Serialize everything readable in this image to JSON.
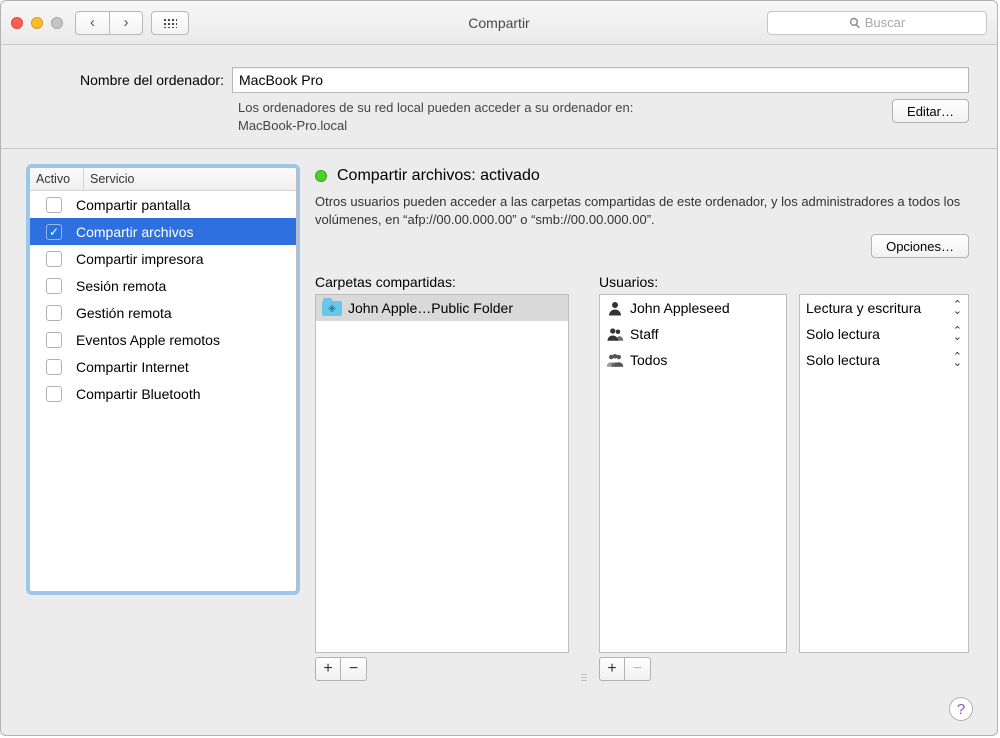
{
  "window": {
    "title": "Compartir",
    "search_placeholder": "Buscar"
  },
  "computerName": {
    "label": "Nombre del ordenador:",
    "value": "MacBook Pro",
    "hint_line1": "Los ordenadores de su red local pueden acceder a su ordenador en:",
    "hint_line2": "MacBook-Pro.local",
    "edit_button": "Editar…"
  },
  "services": {
    "header_active": "Activo",
    "header_service": "Servicio",
    "items": [
      {
        "label": "Compartir pantalla",
        "checked": false,
        "selected": false
      },
      {
        "label": "Compartir archivos",
        "checked": true,
        "selected": true
      },
      {
        "label": "Compartir impresora",
        "checked": false,
        "selected": false
      },
      {
        "label": "Sesión remota",
        "checked": false,
        "selected": false
      },
      {
        "label": "Gestión remota",
        "checked": false,
        "selected": false
      },
      {
        "label": "Eventos Apple remotos",
        "checked": false,
        "selected": false
      },
      {
        "label": "Compartir Internet",
        "checked": false,
        "selected": false
      },
      {
        "label": "Compartir Bluetooth",
        "checked": false,
        "selected": false
      }
    ]
  },
  "status": {
    "indicator": "green",
    "title": "Compartir archivos: activado",
    "description": "Otros usuarios pueden acceder a las carpetas compartidas de este ordenador, y los administradores a todos los volúmenes, en “afp://00.00.000.00” o “smb://00.00.000.00”.",
    "options_button": "Opciones…"
  },
  "folders": {
    "label": "Carpetas compartidas:",
    "items": [
      {
        "label": "John Apple…Public Folder",
        "selected": true
      }
    ]
  },
  "users": {
    "label": "Usuarios:",
    "items": [
      {
        "label": "John Appleseed",
        "icon": "single"
      },
      {
        "label": "Staff",
        "icon": "double"
      },
      {
        "label": "Todos",
        "icon": "triple"
      }
    ]
  },
  "permissions": {
    "items": [
      {
        "label": "Lectura y escritura"
      },
      {
        "label": "Solo lectura"
      },
      {
        "label": "Solo lectura"
      }
    ]
  },
  "buttons": {
    "add": "+",
    "remove": "−"
  }
}
